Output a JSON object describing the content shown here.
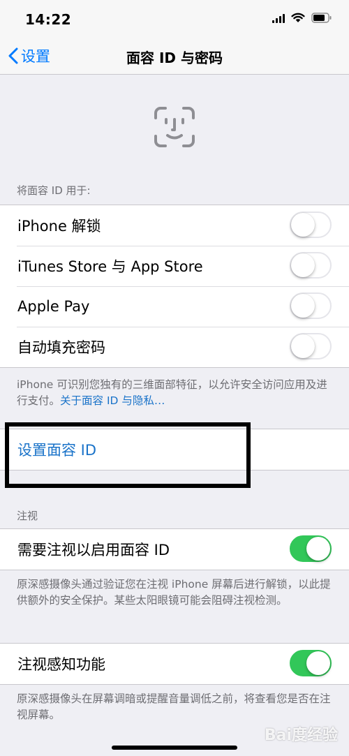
{
  "status_bar": {
    "time": "14:22"
  },
  "nav": {
    "back_label": "设置",
    "title": "面容 ID 与密码"
  },
  "use_for": {
    "header": "将面容 ID 用于:",
    "items": [
      {
        "label": "iPhone 解锁",
        "enabled": false
      },
      {
        "label": "iTunes Store 与 App Store",
        "enabled": false
      },
      {
        "label": "Apple Pay",
        "enabled": false
      },
      {
        "label": "自动填充密码",
        "enabled": false
      }
    ],
    "footer_text": "iPhone 可识别您独有的三维面部特征，以允许安全访问应用及进行支付。",
    "footer_link": "关于面容 ID 与隐私…"
  },
  "setup": {
    "label": "设置面容 ID"
  },
  "attention": {
    "header": "注视",
    "require_label": "需要注视以启用面容 ID",
    "require_enabled": true,
    "require_footer": "原深感摄像头通过验证您在注视 iPhone 屏幕后进行解锁，以此提供额外的安全保护。某些太阳眼镜可能会阻碍注视检测。",
    "aware_label": "注视感知功能",
    "aware_enabled": true,
    "aware_footer": "原深感摄像头在屏幕调暗或提醒音量调低之前，将查看您是否在注视屏幕。"
  },
  "watermark": "Bai度经验",
  "colors": {
    "accent": "#007aff",
    "link": "#1a73c9",
    "toggle_on": "#32c759",
    "background": "#efeff4",
    "secondary_text": "#6d6d72"
  },
  "icons": {
    "back": "chevron-left-icon",
    "face_id": "face-id-icon",
    "signal": "cellular-signal-icon",
    "wifi": "wifi-icon",
    "battery": "battery-icon"
  }
}
